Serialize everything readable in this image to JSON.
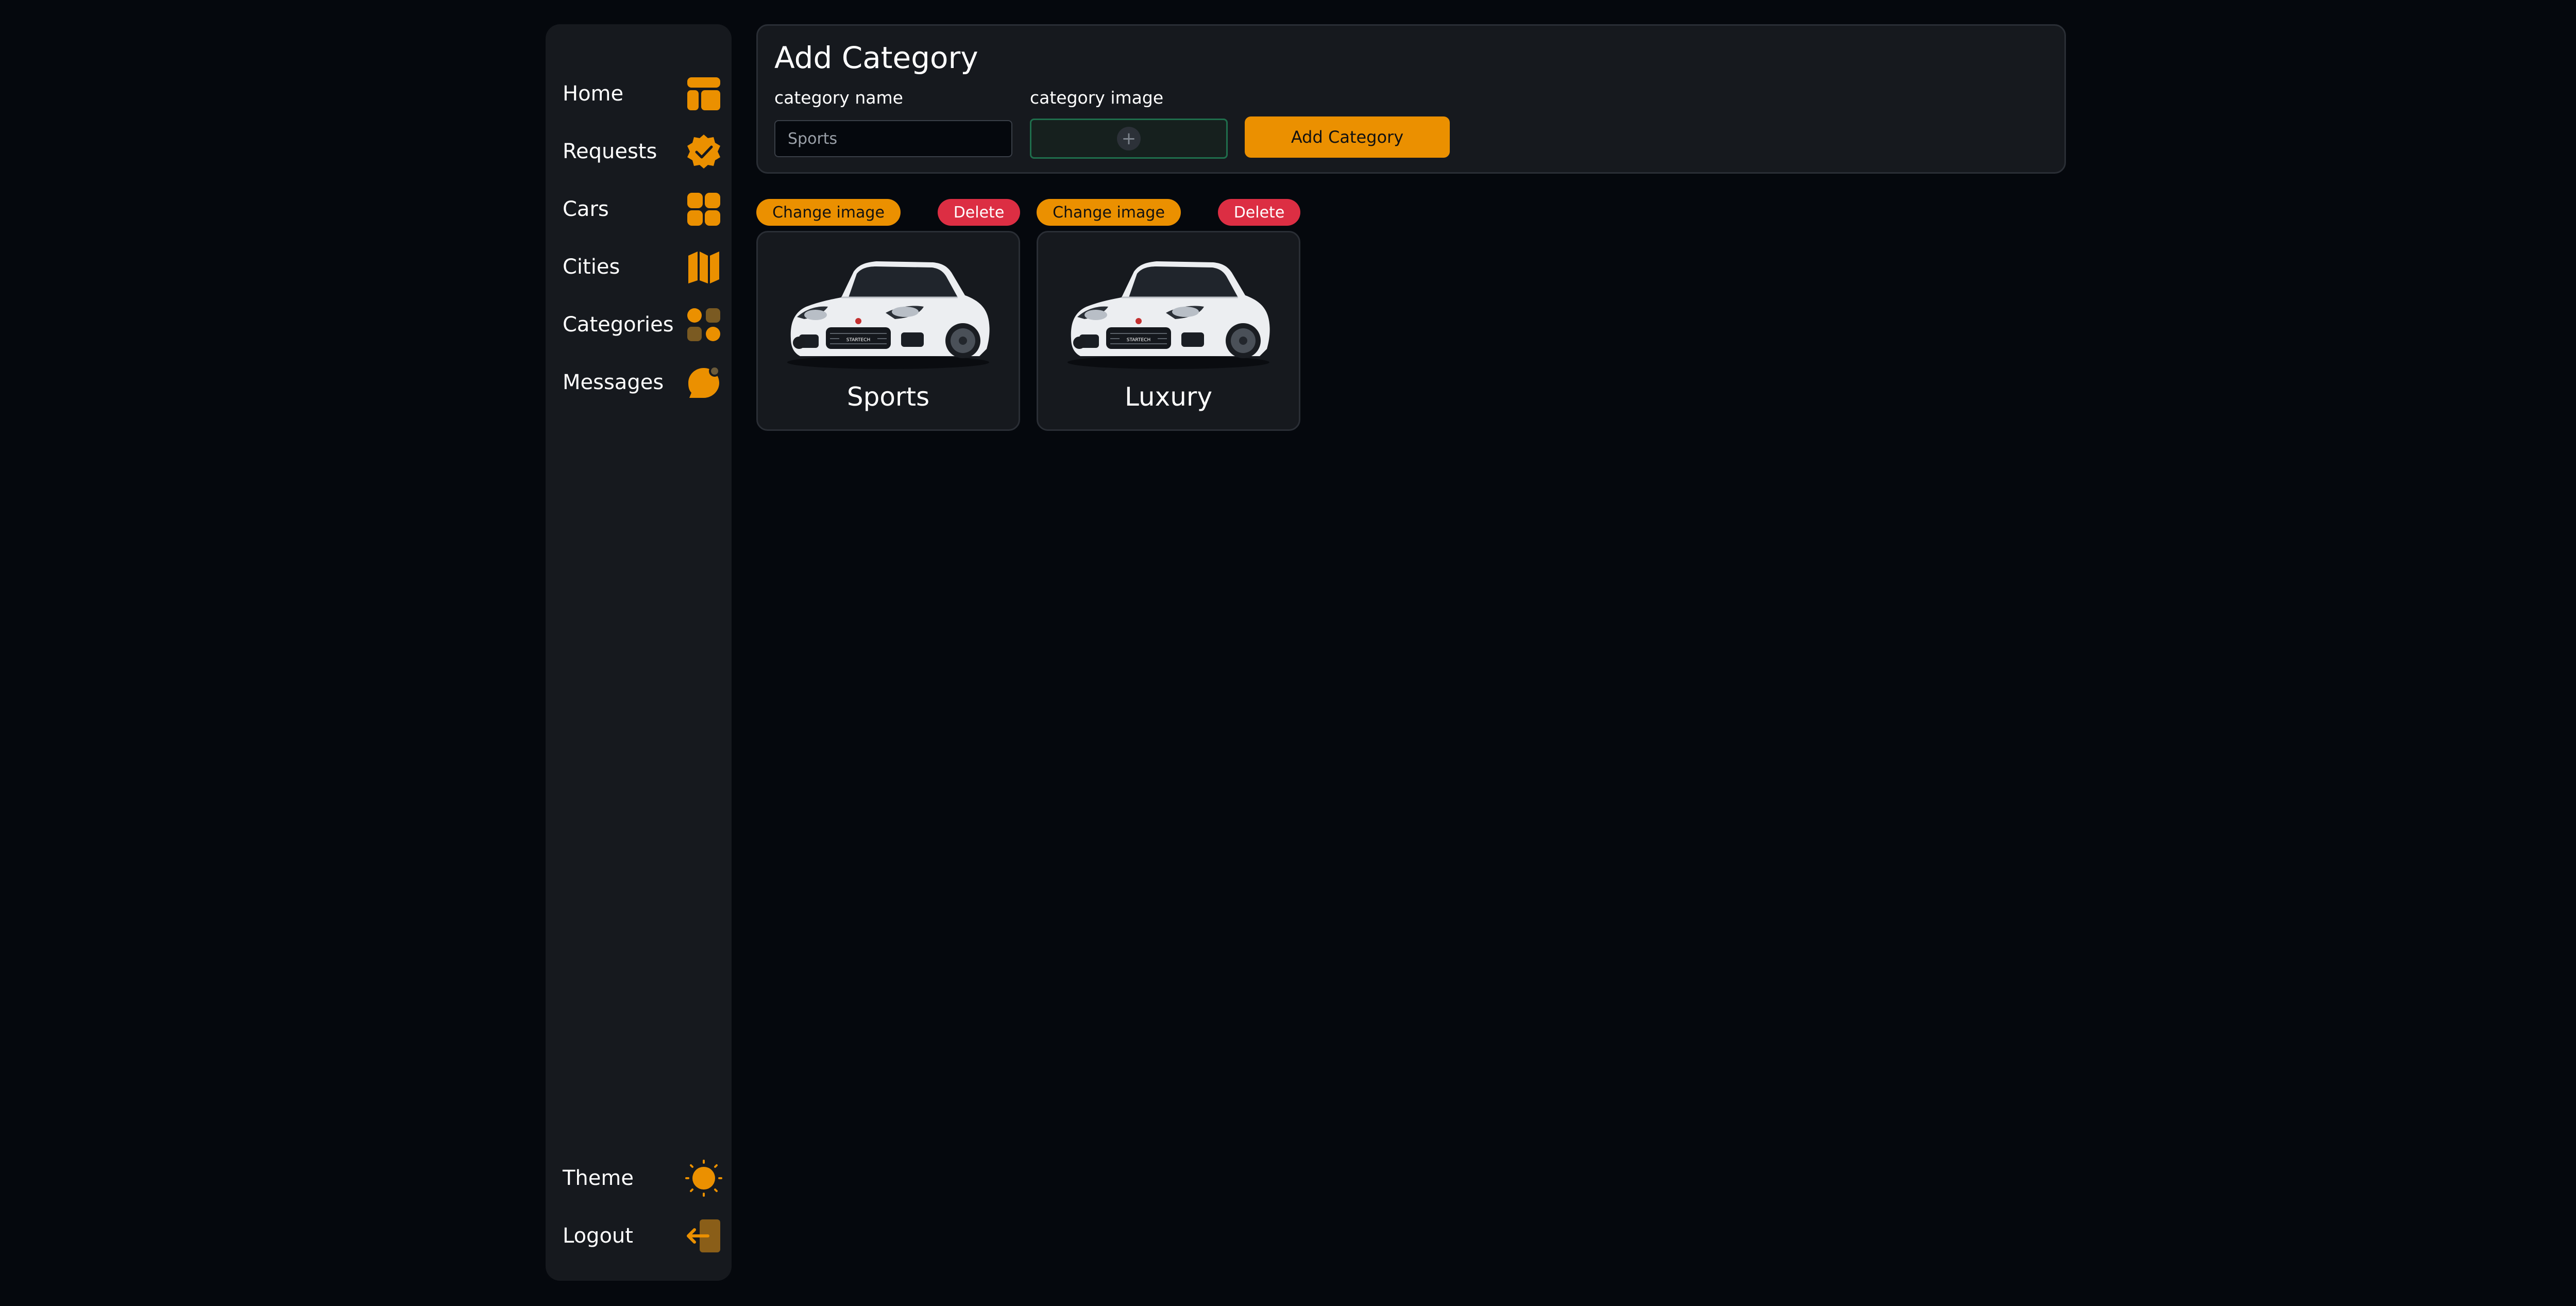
{
  "sidebar": {
    "items": [
      {
        "label": "Home",
        "icon": "layout-icon"
      },
      {
        "label": "Requests",
        "icon": "verified-badge-icon"
      },
      {
        "label": "Cars",
        "icon": "grid-icon"
      },
      {
        "label": "Cities",
        "icon": "map-icon"
      },
      {
        "label": "Categories",
        "icon": "category-dots-icon"
      },
      {
        "label": "Messages",
        "icon": "chat-bubble-icon"
      }
    ],
    "bottom_items": [
      {
        "label": "Theme",
        "icon": "sun-icon"
      },
      {
        "label": "Logout",
        "icon": "logout-icon"
      }
    ]
  },
  "form": {
    "title": "Add Category",
    "name_label": "category name",
    "name_value": "Sports",
    "image_label": "category image",
    "picker_symbol": "+",
    "submit_label": "Add Category"
  },
  "categories": [
    {
      "name": "Sports",
      "change_label": "Change image",
      "delete_label": "Delete",
      "badge": "STARTECH"
    },
    {
      "name": "Luxury",
      "change_label": "Change image",
      "delete_label": "Delete",
      "badge": "STARTECH"
    }
  ],
  "colors": {
    "background": "#05080d",
    "panel": "#16191e",
    "accent": "#eb9000",
    "danger": "#dc2e43",
    "picker_border": "#1f6e4c"
  }
}
